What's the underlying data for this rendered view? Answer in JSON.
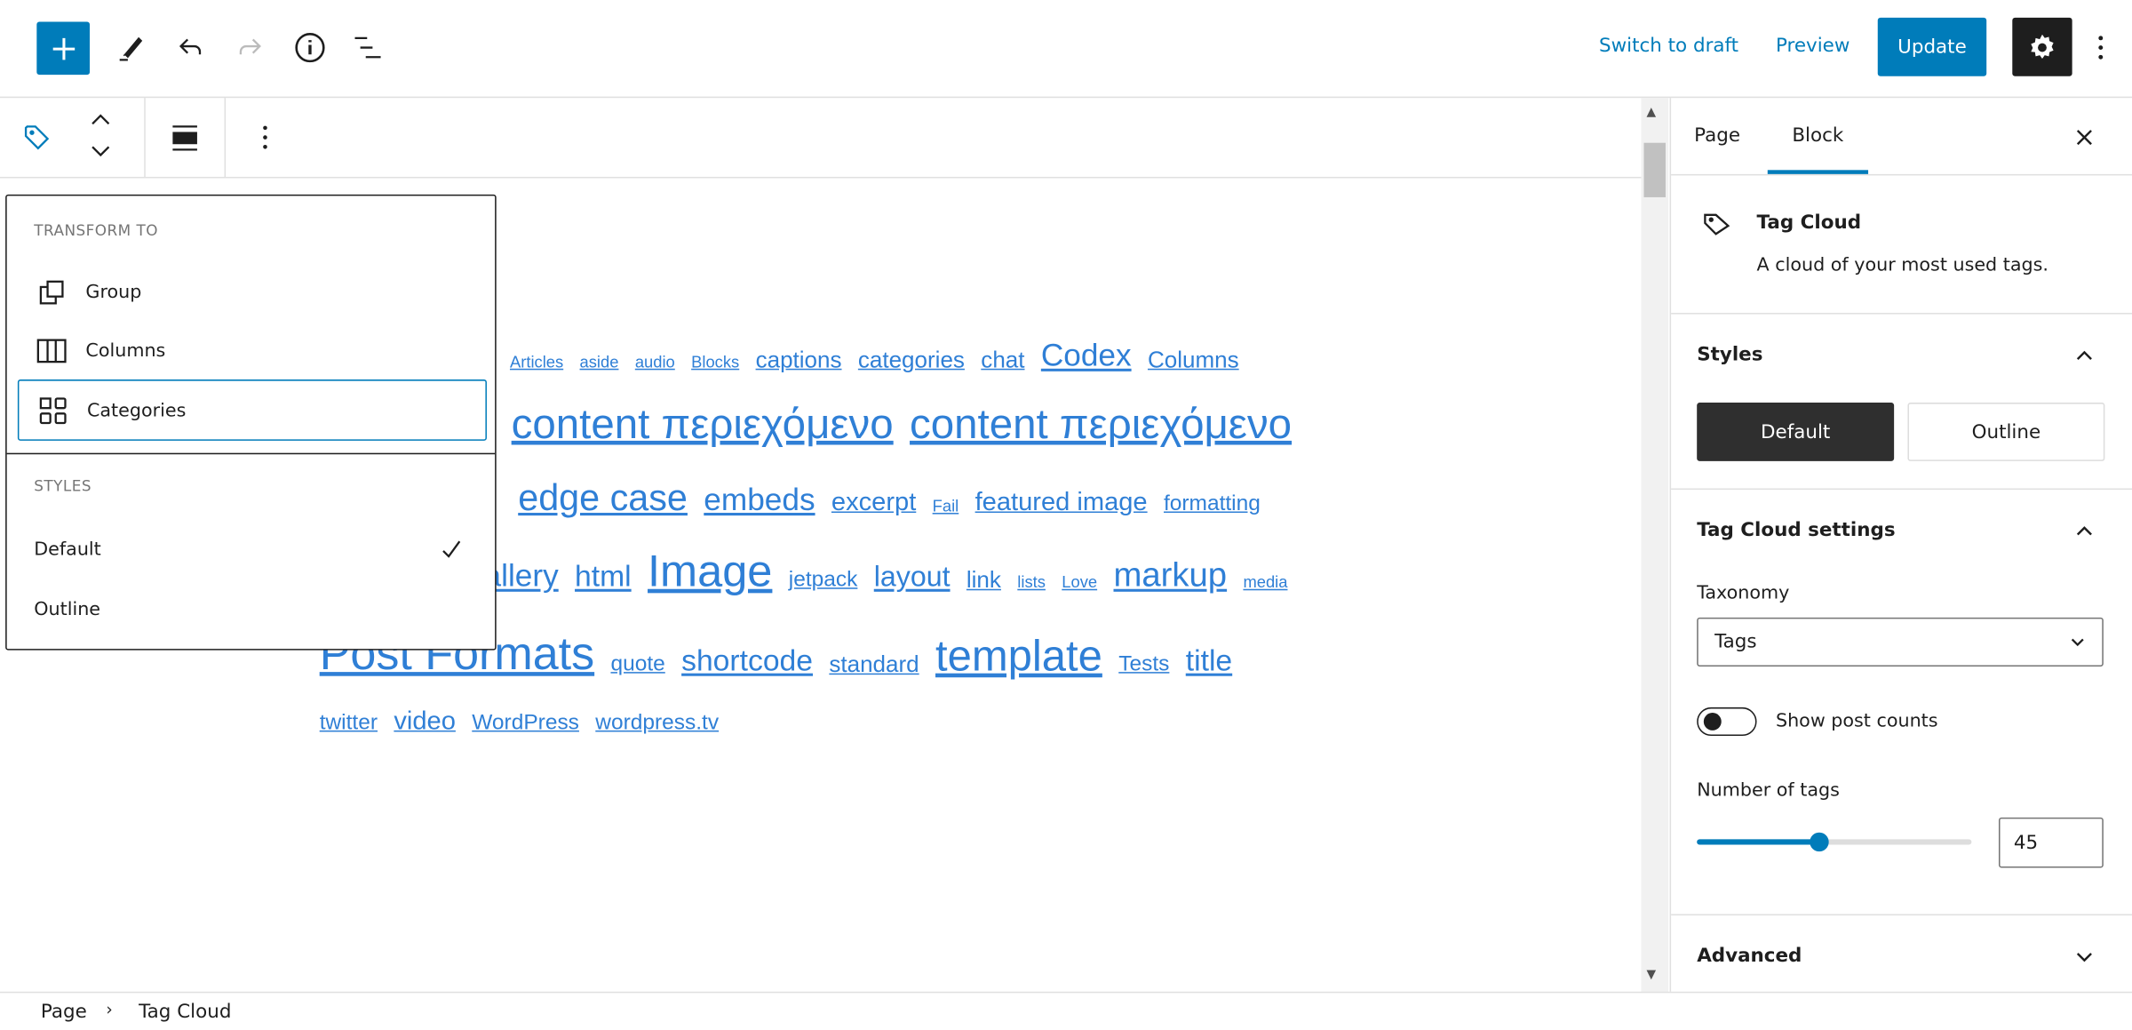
{
  "topbar": {
    "switch_to_draft": "Switch to draft",
    "preview": "Preview",
    "update": "Update",
    "icons": [
      "plus-icon",
      "pencil-icon",
      "undo-icon",
      "redo-icon",
      "info-icon",
      "list-view-icon",
      "gear-icon",
      "more-vertical-icon"
    ]
  },
  "block_toolbar": {
    "icons": [
      "tag-icon",
      "move-up-icon",
      "move-down-icon",
      "align-icon",
      "more-vertical-icon"
    ]
  },
  "tag_cloud": {
    "lines": [
      [
        "Articles",
        "aside",
        "audio",
        "Blocks",
        "captions",
        "categories",
        "chat",
        "Codex",
        "Columns"
      ],
      [
        "content περιεχόμενο",
        "content περιεχόμενο"
      ],
      [
        "edge case",
        "embeds",
        "excerpt",
        "Fail",
        "featured image",
        "formatting"
      ],
      [
        "gallery",
        "html",
        "Image",
        "jetpack",
        "layout",
        "link",
        "lists",
        "Love",
        "markup",
        "media"
      ],
      [
        "Post Formats",
        "quote",
        "shortcode",
        "standard",
        "template",
        "Tests",
        "title"
      ],
      [
        "twitter",
        "video",
        "WordPress",
        "wordpress.tv"
      ]
    ],
    "link_color": "#2f7fd6"
  },
  "transform_menu": {
    "header": "TRANSFORM TO",
    "items": [
      "Group",
      "Columns",
      "Categories"
    ],
    "styles_header": "STYLES",
    "styles": [
      "Default",
      "Outline"
    ],
    "selected_style": "Default",
    "focused_item": "Categories"
  },
  "sidebar": {
    "tabs": [
      "Page",
      "Block"
    ],
    "active_tab": "Block",
    "block": {
      "title": "Tag Cloud",
      "description": "A cloud of your most used tags."
    },
    "styles": {
      "title": "Styles",
      "options": [
        "Default",
        "Outline"
      ],
      "selected": "Default"
    },
    "settings": {
      "title": "Tag Cloud settings",
      "taxonomy_label": "Taxonomy",
      "taxonomy_value": "Tags",
      "show_counts_label": "Show post counts",
      "show_counts": false,
      "number_label": "Number of tags",
      "number_value": "45",
      "slider_min": 1,
      "slider_max": 100,
      "slider_value": 45
    },
    "advanced": {
      "title": "Advanced"
    }
  },
  "breadcrumb": [
    "Page",
    "Tag Cloud"
  ],
  "colors": {
    "accent": "#007cba",
    "dark": "#1e1e1e"
  }
}
